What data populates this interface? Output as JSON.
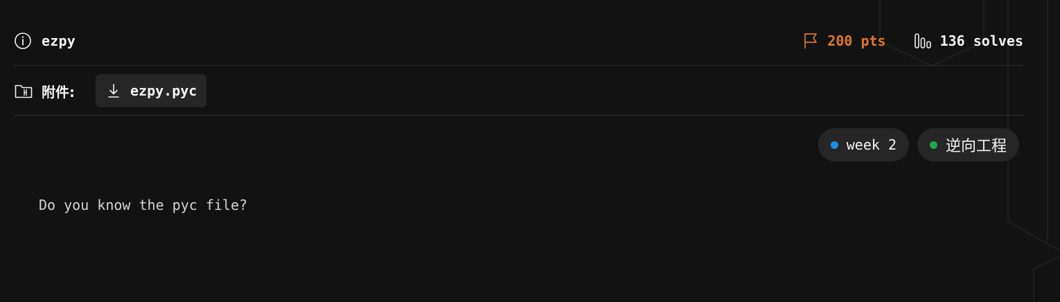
{
  "challenge": {
    "title": "ezpy",
    "points": "200 pts",
    "solves": "136 solves"
  },
  "attachments": {
    "label": "附件:",
    "files": [
      {
        "name": "ezpy.pyc"
      }
    ]
  },
  "tags": [
    {
      "label": "week 2",
      "color": "#1a8fe6"
    },
    {
      "label": "逆向工程",
      "color": "#22a852"
    }
  ],
  "description": "Do you know the pyc file?",
  "colors": {
    "background": "#121212",
    "points_accent": "#e0762a",
    "chip_background": "#262626"
  },
  "icons": {
    "title": "info-icon",
    "points": "flag-icon",
    "solves": "bar-chart-icon",
    "attachments": "folder-icon",
    "file": "download-icon"
  }
}
